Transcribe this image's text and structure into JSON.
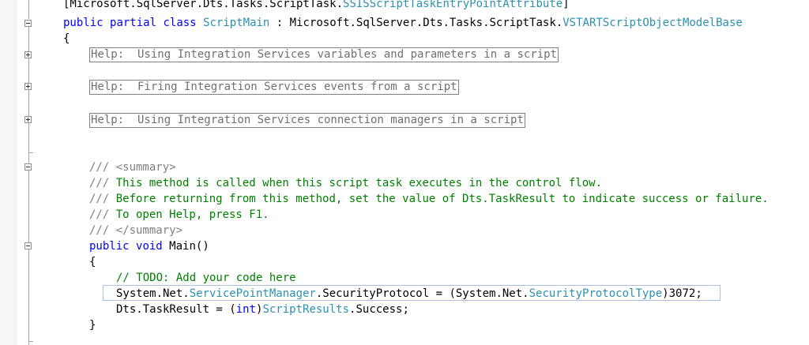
{
  "code": {
    "line_attribute": {
      "open": "[Microsoft.SqlServer.Dts.Tasks.ScriptTask.",
      "type": "SSISScriptTaskEntryPointAttribute",
      "close": "]"
    },
    "line_class": {
      "kw_public": "public",
      "kw_partial": "partial",
      "kw_class": "class",
      "class_name": "ScriptMain",
      "sep": " : Microsoft.SqlServer.Dts.Tasks.ScriptTask.",
      "base_type": "VSTARTScriptObjectModelBase"
    },
    "brace_open": "{",
    "brace_close": "}",
    "help_regions": [
      "Help:  Using Integration Services variables and parameters in a script",
      "Help:  Firing Integration Services events from a script",
      "Help:  Using Integration Services connection managers in a script"
    ],
    "doc_comment": {
      "prefix": "/// ",
      "summary_open": "<summary>",
      "summary_close": "</summary>",
      "text": [
        "This method is called when this script task executes in the control flow.",
        "Before returning from this method, set the value of Dts.TaskResult to indicate success or failure.",
        "To open Help, press F1."
      ]
    },
    "method_sig": {
      "kw_public": "public",
      "kw_void": "void",
      "name": "Main()"
    },
    "todo_comment": "// TODO: Add your code here",
    "security_line": {
      "a": "System.Net.",
      "t1": "ServicePointManager",
      "b": ".SecurityProtocol = (System.Net.",
      "t2": "SecurityProtocolType",
      "c": ")3072;"
    },
    "result_line": {
      "a": "Dts.TaskResult = (",
      "kw_int": "int",
      "b": ")",
      "t1": "ScriptResults",
      "c": ".Success;"
    }
  },
  "colors": {
    "keyword": "#0000ff",
    "type": "#2b91af",
    "comment": "#008000",
    "doc_tag": "#808080"
  }
}
